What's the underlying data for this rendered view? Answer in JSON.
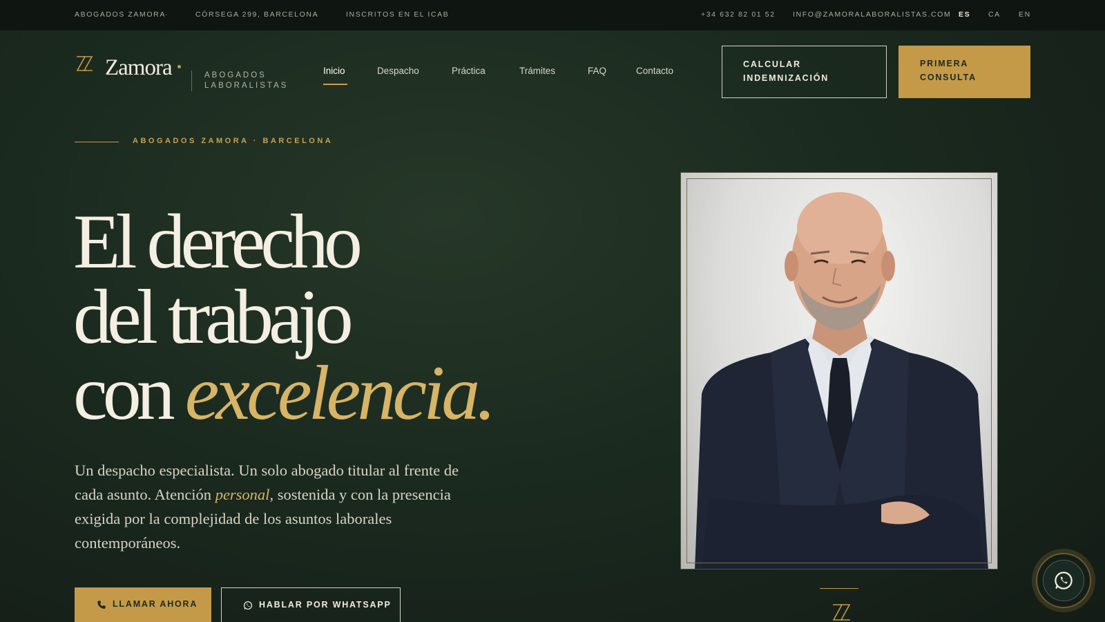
{
  "topbar": {
    "brand": "ABOGADOS ZAMORA",
    "address": "CÒRSEGA 299, BARCELONA",
    "registry": "INSCRITOS EN EL ICAB",
    "phone": "+34 632 82 01 52",
    "email": "INFO@ZAMORALABORALISTAS.COM",
    "languages": [
      "ES",
      "CA",
      "EN"
    ],
    "active_language": "ES",
    "separator": "·"
  },
  "header": {
    "logo_name": "Zamora",
    "logo_tagline_line1": "ABOGADOS",
    "logo_tagline_line2": "LABORALISTAS",
    "nav": [
      {
        "label": "Inicio",
        "active": true
      },
      {
        "label": "Despacho",
        "active": false
      },
      {
        "label": "Práctica",
        "active": false
      },
      {
        "label": "Trámites",
        "active": false
      },
      {
        "label": "FAQ",
        "active": false
      },
      {
        "label": "Contacto",
        "active": false
      }
    ],
    "cta_outline_line1": "CALCULAR",
    "cta_outline_line2": "INDEMNIZACIÓN",
    "cta_primary_line1": "PRIMERA",
    "cta_primary_line2": "CONSULTA"
  },
  "hero": {
    "eyebrow": "ABOGADOS ZAMORA · BARCELONA",
    "title_line1": "El derecho",
    "title_line2": "del trabajo",
    "title_line3_plain": "con ",
    "title_line3_accent": "excelencia.",
    "lede_part1": "Un despacho especialista. Un solo abogado titular al frente de cada asunto. Atención ",
    "lede_emphasis": "personal",
    "lede_part2": ", sostenida y con la presencia exigida por la complejidad de los asuntos laborales contemporáneos.",
    "btn_call": "LLAMAR AHORA",
    "btn_whatsapp": "HABLAR POR WHATSAPP"
  },
  "icons": {
    "logo": "zz-monogram-icon",
    "phone": "phone-icon",
    "whatsapp": "whatsapp-icon"
  },
  "colors": {
    "background": "#1b2a1f",
    "gold": "#c49a48",
    "accent_text": "#d8b466",
    "text": "#f1ece0"
  }
}
